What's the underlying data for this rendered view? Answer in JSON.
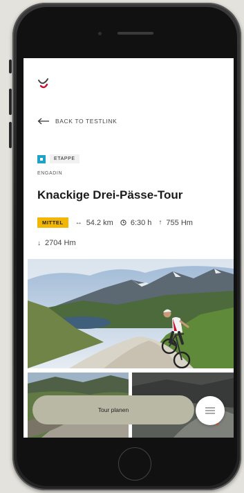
{
  "nav": {
    "back_label": "BACK TO TESTLINK"
  },
  "tour": {
    "type_label": "ETAPPE",
    "region": "ENGADIN",
    "title": "Knackige Drei-Pässe-Tour",
    "difficulty": "MITTEL",
    "distance": "54.2 km",
    "duration": "6:30 h",
    "ascent": "755 Hm",
    "descent": "2704 Hm"
  },
  "actions": {
    "plan_label": "Tour planen"
  },
  "icons": {
    "logo": "brand-logo-icon",
    "back": "arrow-left-icon",
    "type": "stage-square-icon",
    "distance": "horizontal-arrows-icon",
    "duration": "clock-icon",
    "ascent": "arrow-up-icon",
    "descent": "arrow-down-icon",
    "menu": "hamburger-menu-icon"
  },
  "colors": {
    "accent_badge": "#f2b705",
    "type_square": "#1fa3c4",
    "plan_button": "#b9b8a4",
    "logo_red": "#c8102e"
  }
}
